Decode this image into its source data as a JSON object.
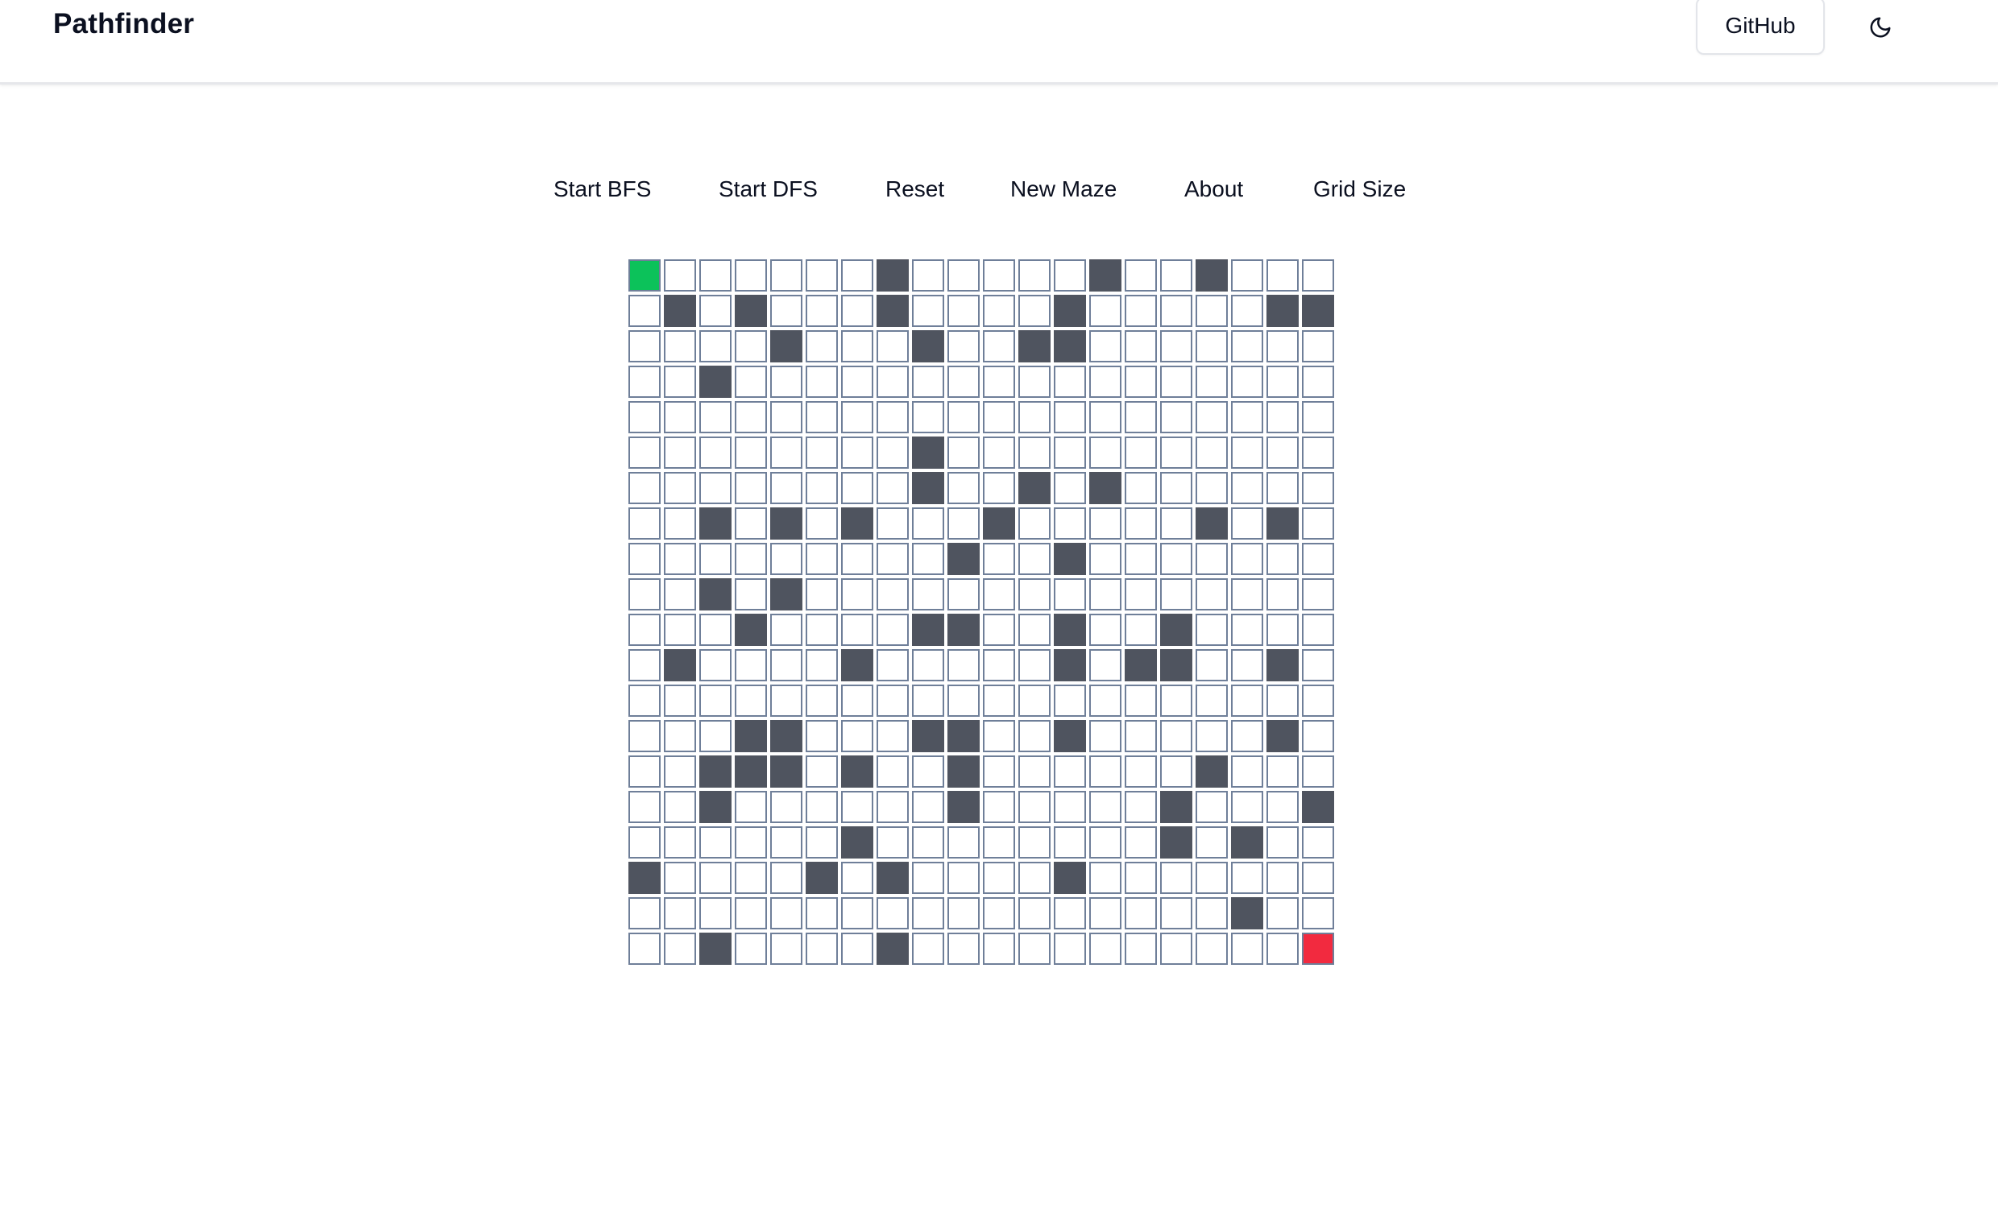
{
  "app": {
    "title": "Pathfinder"
  },
  "header": {
    "github_label": "GitHub",
    "theme_icon": "moon-icon"
  },
  "toolbar": {
    "buttons": [
      {
        "id": "start-bfs",
        "label": "Start BFS"
      },
      {
        "id": "start-dfs",
        "label": "Start DFS"
      },
      {
        "id": "reset",
        "label": "Reset"
      },
      {
        "id": "new-maze",
        "label": "New Maze"
      },
      {
        "id": "about",
        "label": "About"
      },
      {
        "id": "grid-size",
        "label": "Grid Size"
      }
    ]
  },
  "grid": {
    "rows": 20,
    "cols": 20,
    "colors": {
      "wall": "#4f545f",
      "start": "#0cc25a",
      "end": "#f22a3f",
      "empty": "#ffffff",
      "border": "#6f7f99"
    },
    "cells": [
      "S......#.....#..#...",
      ".#.#...#....#.....##",
      "....#...#..##.......",
      "..#.................",
      "....................",
      "........#...........",
      "........#..#.#......",
      "..#.#.#...#.....#.#.",
      ".........#..#.......",
      "..#.#...............",
      "...#....##..#..#....",
      ".#....#.....#.##..#.",
      "....................",
      "...##...##..#.....#.",
      "..###.#..#......#...",
      "..#......#.....#...#",
      "......#........#.#..",
      "#....#.#....#.......",
      ".................#..",
      "..#....#...........E"
    ]
  }
}
